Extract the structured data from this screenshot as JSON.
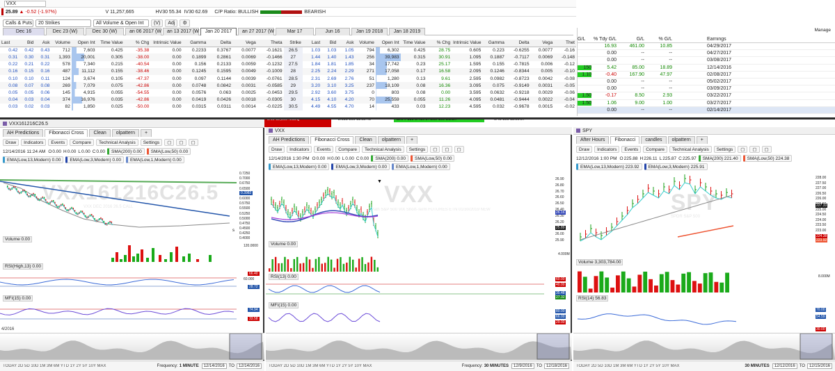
{
  "quote": {
    "symbol": "VXX",
    "price": "25.89",
    "change": "-0.52 (-1.97%)",
    "volume": "V 11,257,665",
    "hv30": "HV30 55.34",
    "iv30": "IV30 62.69",
    "cp_ratio_label": "C/P Ratio:",
    "bullish": "BULLISH",
    "bearish": "BEARISH",
    "search_value": "VXX"
  },
  "chain_controls": {
    "calls_puts": "Calls & Puts",
    "strikes": "20 Strikes",
    "filter": "All Volume & Open Int",
    "v_btn": "(V)",
    "adj_btn": "Adj"
  },
  "expirations": [
    "Dec 16",
    "Dec 23 (W)",
    "Dec 30 (W)",
    "an 06 2017 (W",
    "an 13 2017 (W",
    "Jan 20 2017",
    "an 27 2017 (W",
    "Mar 17",
    "Jun 16",
    "Jan 19 2018",
    "Jan 18 2019"
  ],
  "chain_headers": [
    "Last",
    "Bid",
    "Ask",
    "Volume",
    "Open Int",
    "Time Value",
    "% Chg",
    "Intrinsic Value",
    "Gamma",
    "Delta",
    "Vega",
    "Theta",
    "Strike",
    "Last",
    "Bid",
    "Ask",
    "Volume",
    "Open Int",
    "Time Value",
    "% Chg",
    "Intrinsic Value",
    "Gamma",
    "Delta",
    "Vega",
    "Thet"
  ],
  "chain_rows": [
    [
      "0.42",
      "0.42",
      "0.43",
      "712",
      "7,603",
      "0.425",
      "-35.38",
      "0.00",
      "0.2233",
      "0.3767",
      "0.0077",
      "-0.1621",
      "26.5",
      "1.03",
      "1.03",
      "1.05",
      "794",
      "6,302",
      "0.425",
      "28.75",
      "0.605",
      "0.223",
      "-0.6255",
      "0.0077",
      "-0.16"
    ],
    [
      "0.31",
      "0.30",
      "0.31",
      "1,393",
      "20,001",
      "0.305",
      "-38.00",
      "0.00",
      "0.1899",
      "0.2861",
      "0.0069",
      "-0.1466",
      "27",
      "1.44",
      "1.40",
      "1.43",
      "256",
      "39,983",
      "0.315",
      "30.91",
      "1.095",
      "0.1887",
      "-0.7117",
      "0.0069",
      "-0.148"
    ],
    [
      "0.22",
      "0.21",
      "0.22",
      "578",
      "7,340",
      "0.215",
      "-40.54",
      "0.00",
      "0.156",
      "0.2133",
      "0.0059",
      "-0.1232",
      "27.5",
      "1.84",
      "1.81",
      "1.85",
      "34",
      "17,742",
      "0.23",
      "25.17",
      "1.595",
      "0.155",
      "-0.7815",
      "0.006",
      "-0.12"
    ],
    [
      "0.16",
      "0.15",
      "0.16",
      "487",
      "11,112",
      "0.155",
      "-38.46",
      "0.00",
      "0.1245",
      "0.1595",
      "0.0049",
      "-0.1009",
      "28",
      "2.25",
      "2.24",
      "2.29",
      "271",
      "17,058",
      "0.17",
      "16.58",
      "2.095",
      "0.1246",
      "-0.8344",
      "0.005",
      "-0.10"
    ],
    [
      "0.10",
      "0.10",
      "0.11",
      "124",
      "3,674",
      "0.105",
      "-47.37",
      "0.00",
      "0.097",
      "0.1144",
      "0.0039",
      "-0.0761",
      "28.5",
      "2.31",
      "2.69",
      "2.76",
      "51",
      "1,280",
      "0.13",
      "9.61",
      "2.595",
      "0.0982",
      "-0.8723",
      "0.0042",
      "-0.08"
    ],
    [
      "0.08",
      "0.07",
      "0.08",
      "269",
      "7,079",
      "0.075",
      "-42.86",
      "0.00",
      "0.0748",
      "0.0842",
      "0.0031",
      "-0.0585",
      "29",
      "3.20",
      "3.10",
      "3.25",
      "237",
      "18,109",
      "0.08",
      "16.36",
      "3.095",
      "0.075",
      "-0.9149",
      "0.0031",
      "-0.05"
    ],
    [
      "0.05",
      "0.05",
      "0.06",
      "145",
      "4,915",
      "0.055",
      "-54.55",
      "0.00",
      "0.0576",
      "0.063",
      "0.0025",
      "-0.0453",
      "29.5",
      "2.92",
      "3.60",
      "3.75",
      "0",
      "803",
      "0.08",
      "0.00",
      "3.595",
      "0.0632",
      "-0.9218",
      "0.0029",
      "-0.06"
    ],
    [
      "0.04",
      "0.03",
      "0.04",
      "374",
      "16,976",
      "0.035",
      "-42.86",
      "0.00",
      "0.0419",
      "0.0426",
      "0.0018",
      "-0.0305",
      "30",
      "4.15",
      "4.10",
      "4.20",
      "70",
      "25,559",
      "0.055",
      "11.26",
      "4.095",
      "0.0481",
      "-0.9444",
      "0.0022",
      "-0.04"
    ],
    [
      "0.03",
      "0.02",
      "0.03",
      "82",
      "1,850",
      "0.025",
      "-50.00",
      "0.00",
      "0.0315",
      "0.0311",
      "0.0014",
      "-0.0225",
      "30.5",
      "4.49",
      "4.55",
      "4.70",
      "14",
      "433",
      "0.03",
      "12.23",
      "4.595",
      "0.032",
      "-0.9678",
      "0.0015",
      "-0.02"
    ]
  ],
  "positions": {
    "headers": [
      "G/L",
      "% Tdy G/L",
      "G/L",
      "% G/L",
      "Earnings Date"
    ],
    "manage": "Manage",
    "rows": [
      [
        "",
        "16.93",
        "461.00",
        "10.85",
        "04/29/2017"
      ],
      [
        "",
        "0.00",
        "--",
        "--",
        "04/27/2017"
      ],
      [
        "",
        "0.00",
        "--",
        "--",
        "03/08/2017"
      ],
      [
        "150",
        "5.42",
        "85.00",
        "18.89",
        "12/14/2016"
      ],
      [
        "1.10",
        "-0.40",
        "167.90",
        "47.97",
        "02/08/2017"
      ],
      [
        "",
        "0.00",
        "--",
        "--",
        "05/02/2017"
      ],
      [
        "",
        "0.00",
        "--",
        "--",
        "03/09/2017"
      ],
      [
        "1.50",
        "-0.17",
        "8.50",
        "2.93",
        "03/22/2017"
      ],
      [
        "1.50",
        "1.06",
        "9.00",
        "1.00",
        "03/27/2017"
      ],
      [
        "",
        "0.00",
        "--",
        "--",
        "02/14/2017"
      ]
    ]
  },
  "ticker_strip": {
    "a": "3.02",
    "b": "32,500",
    "c": "NSDQ",
    "d": "2.985",
    "e": "100",
    "f": "11:05:45",
    "g": "BATY",
    "h": "100",
    "i": "0.416",
    "j": "0.4199",
    "k": "100",
    "l": "BOSX",
    "m": "0.42",
    "n": "100",
    "o": "11:06:07"
  },
  "chart_left": {
    "tab_title": "VXX161216C26.5",
    "tabs": [
      "AH Predictions",
      "Fibonacci Cross",
      "Clean",
      "olpattern",
      "+"
    ],
    "menu": [
      "Draw",
      "Indicators",
      "Events",
      "Compare",
      "Technical Analysis",
      "Settings"
    ],
    "stamp": "12/14/2016 11:24 AM",
    "o": "0.00",
    "h": "0.00",
    "l": "0.00",
    "c": "0.00",
    "ind1": "SMA(200) 0.00",
    "ind2": "SMA(Low,50) 0.00",
    "ind3": "EMA(Low,13,Modern) 0.00",
    "ind4": "EMA(Low,3,Modern) 0.00",
    "ind5": "EMA(Low,1,Modern) 0.00",
    "watermark": "VXX161216C26.5",
    "wm_sub": "VXX DEC 2016 26.5 CALL",
    "ticks": [
      "0.7250",
      "0.7000",
      "0.6750",
      "0.6500",
      "0.6250",
      "0.6000",
      "0.5750",
      "0.5500",
      "0.5250",
      "0.5000",
      "0.4750",
      "0.4500",
      "0.4250",
      "0.4000"
    ],
    "tick_last": "0.3982",
    "volume": "Volume 0.00",
    "vol_axis": "120.0000",
    "rsi": "RSI(High,13) 0.00",
    "rsi_ax": [
      "60.000",
      "50.0000"
    ],
    "rsi_flags": [
      "66.40",
      "28.72"
    ],
    "mfi": "MFI(15) 0.00",
    "mfi_flags": [
      "74.94",
      "33.58"
    ],
    "date_start": "4/2016",
    "periods": "TODAY 2D 5D 10D 1M 3M 6M YTD 1Y 2Y 5Y 10Y MAX",
    "freq_label": "Frequency:",
    "freq": "1 MINUTE",
    "from": "12/14/2016",
    "to_label": "TO",
    "to": "12/14/2016"
  },
  "chart_mid": {
    "tab_title": "VXX",
    "tabs": [
      "AH Predictions",
      "Fibonacci Cross",
      "Clean",
      "olpattern",
      "+"
    ],
    "menu": [
      "Draw",
      "Indicators",
      "Events",
      "Compare",
      "Technical Analysis",
      "Settings"
    ],
    "stamp": "12/14/2016 1:30 PM",
    "o": "0.00",
    "h": "0.00",
    "l": "0.00",
    "c": "0.00",
    "ind1": "SMA(200) 0.00",
    "ind2": "SMA(Low,50) 0.00",
    "ind3": "EMA(Low,13,Modern) 0.00",
    "ind4": "EMA(Low,3,Modern) 0.00",
    "ind5": "EMA(Low,1,Modern) 0.00",
    "watermark": "VXX",
    "wm_sub": "iPath S&P 500 VIX Short-Term FUTURES ETN 01/30/2019 NEW",
    "ticks": [
      "26.90",
      "26.80",
      "26.70",
      "26.60",
      "26.50",
      "26.40",
      "26.30",
      "26.20",
      "26.10",
      "26.00",
      "25.90"
    ],
    "tick_flags": [
      "26.16",
      "25.89"
    ],
    "volume": "Volume 0.00",
    "vol_axis": "4.000M",
    "rsi": "RSI(13) 0.00",
    "rsi_flags": [
      "60.00",
      "40.00",
      "35.48",
      "27.32"
    ],
    "mfi": "MFI(15) 0.00",
    "mfi_flags": [
      "80.00",
      "66.00",
      "29.00"
    ],
    "dates": [
      "12/12/2016",
      "12/13/2016",
      "12/14/2016",
      "12/15/2016",
      "12/16/2016",
      "12/17/2016",
      "12/18/2016"
    ],
    "periods": "TODAY 2D 5D 10D 1M 3M 6M YTD 1Y 2Y 5Y 10Y MAX",
    "freq_label": "Frequency:",
    "freq": "30 MINUTES",
    "from": "12/9/2016",
    "to_label": "TO",
    "to": "12/18/2016"
  },
  "chart_right": {
    "tab_title": "SPY",
    "tabs": [
      "After Hours",
      "Fibonacci",
      "candles",
      "olpattern",
      "+"
    ],
    "menu": [
      "Draw",
      "Indicators",
      "Events",
      "Compare",
      "Technical Analysis",
      "Settings"
    ],
    "stamp": "12/12/2016 1:00 PM",
    "o": "225.88",
    "h": "226.11",
    "l": "225.87",
    "c": "225.97",
    "ind1": "SMA(200) 221.40",
    "ind2": "SMA(Low,50) 224.38",
    "ind3": "EMA(Low,13,Modern) 223.92",
    "ind4": "EMA(Low,3,Modern) 225.91",
    "watermark": "SPY",
    "wm_sub": "SPDR S&P 500",
    "ticks": [
      "228.00",
      "227.50",
      "227.00",
      "226.50",
      "226.00",
      "225.50",
      "225.00",
      "224.50",
      "224.00",
      "223.50",
      "223.00",
      "222.50",
      "222.00"
    ],
    "tick_flags": [
      "227.33",
      "224.38",
      "223.92"
    ],
    "volume": "Volume 3,303,784.00",
    "vol_axis": "8.000M",
    "rsi": "RSI(14) 56.83",
    "rsi_flags": [
      "70.00",
      "54.59",
      "30.00"
    ],
    "dates": [
      "12/13/2016",
      "12/14/2016",
      "12/15/2016"
    ],
    "periods": "TODAY 2D 5D 10D 1M 3M 6M YTD 1Y 2Y 5Y 10Y MAX",
    "freq": "30 MINUTES",
    "from": "12/12/2016",
    "to_label": "TO",
    "to": "12/15/2016"
  }
}
